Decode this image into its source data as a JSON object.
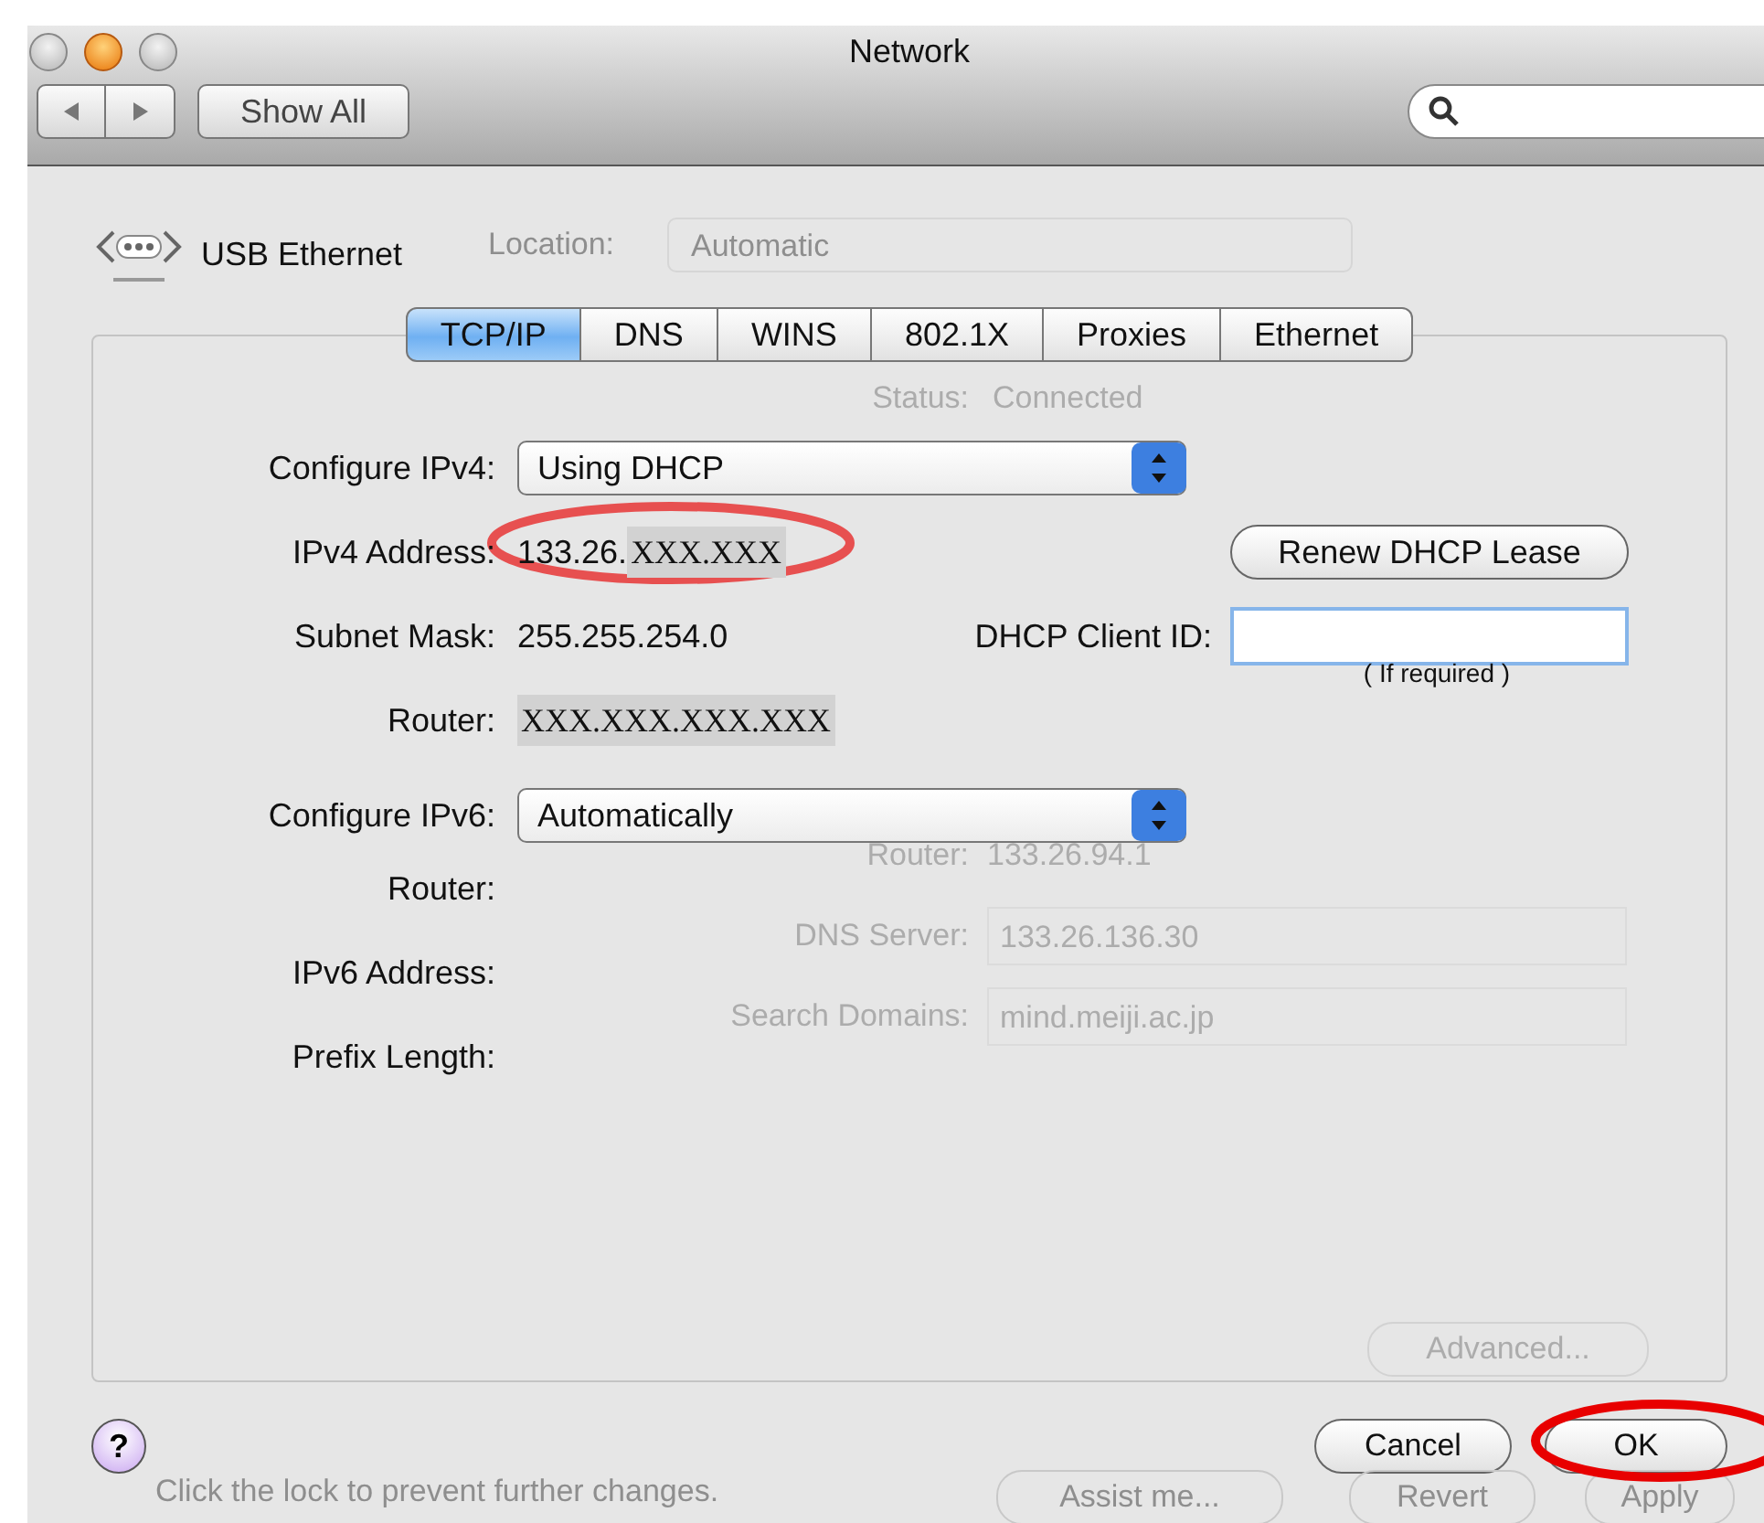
{
  "window": {
    "title": "Network"
  },
  "toolbar": {
    "show_all": "Show All"
  },
  "device": {
    "name": "USB Ethernet"
  },
  "background": {
    "location_label": "Location:",
    "location_value": "Automatic",
    "status_label": "Status:",
    "status_value": "Connected",
    "fields": [
      {
        "label": "Router:",
        "value": "133.26.94.1",
        "boxed": false
      },
      {
        "label": "DNS Server:",
        "value": "133.26.136.30",
        "boxed": true
      },
      {
        "label": "Search Domains:",
        "value": "mind.meiji.ac.jp",
        "boxed": true
      }
    ],
    "advanced": "Advanced...",
    "lock_text": "Click the lock to prevent further changes.",
    "buttons": [
      "Assist me...",
      "Revert",
      "Apply"
    ]
  },
  "tabs": [
    {
      "label": "TCP/IP",
      "selected": true
    },
    {
      "label": "DNS",
      "selected": false
    },
    {
      "label": "WINS",
      "selected": false
    },
    {
      "label": "802.1X",
      "selected": false
    },
    {
      "label": "Proxies",
      "selected": false
    },
    {
      "label": "Ethernet",
      "selected": false
    }
  ],
  "ipv4": {
    "label": "Configure IPv4:",
    "value": "Using DHCP"
  },
  "address": {
    "label": "IPv4 Address:",
    "value": "133.26.",
    "redacted": "XXX.XXX"
  },
  "subnet": {
    "label": "Subnet Mask:",
    "value": "255.255.254.0"
  },
  "router": {
    "label": "Router:",
    "redacted": "XXX.XXX.XXX.XXX"
  },
  "renew_button": "Renew DHCP Lease",
  "client_id": {
    "label": "DHCP Client ID:",
    "caption": "( If required )"
  },
  "ipv6": {
    "label": "Configure IPv6:",
    "value": "Automatically"
  },
  "fields6": [
    {
      "label": "Router:"
    },
    {
      "label": "IPv6 Address:"
    },
    {
      "label": "Prefix Length:"
    }
  ],
  "help_button": "?",
  "buttons": [
    "Cancel",
    "OK"
  ]
}
